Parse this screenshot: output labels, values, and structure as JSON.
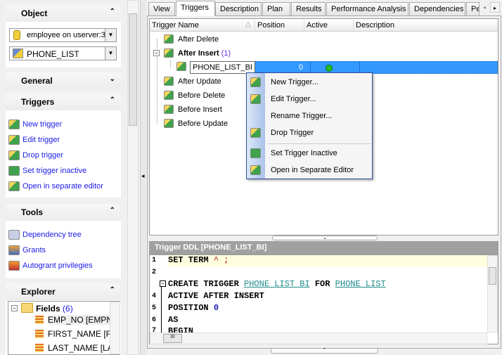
{
  "left": {
    "object": {
      "title": "Object",
      "database": "employee on userver:3",
      "table": "PHONE_LIST"
    },
    "general": {
      "title": "General"
    },
    "triggers": {
      "title": "Triggers",
      "items": [
        "New trigger",
        "Edit trigger",
        "Drop trigger",
        "Set trigger inactive",
        "Open in separate editor"
      ]
    },
    "tools": {
      "title": "Tools",
      "items": [
        "Dependency tree",
        "Grants",
        "Autogrant privilegies"
      ]
    },
    "explorer": {
      "title": "Explorer",
      "fields_label": "Fields",
      "fields_count": "(6)",
      "fields": [
        "EMP_NO [EMPN",
        "FIRST_NAME [FI",
        "LAST_NAME [LA"
      ]
    }
  },
  "tabs": [
    "View",
    "Triggers",
    "Description",
    "Plan",
    "Results",
    "Performance Analysis",
    "Dependencies",
    "Pe"
  ],
  "active_tab": "Triggers",
  "grid": {
    "columns": [
      "Trigger Name",
      "Position",
      "Active",
      "Description"
    ],
    "groups": [
      "After Delete",
      "After Insert",
      "After Update",
      "Before Delete",
      "Before Insert",
      "Before Update"
    ],
    "after_insert_count": "(1)",
    "selected": {
      "name": "PHONE_LIST_BI",
      "position": "0",
      "active": true
    }
  },
  "context_menu": [
    "New Trigger...",
    "Edit Trigger...",
    "Rename Trigger...",
    "Drop Trigger",
    "Set Trigger Inactive",
    "Open in Separate Editor"
  ],
  "ddl": {
    "title": "Trigger DDL [PHONE_LIST_BI]",
    "line_numbers": [
      "1",
      "2",
      "",
      "4",
      "5",
      "6",
      "7"
    ],
    "lines": {
      "l1a": "SET TERM ",
      "l1b": "^ ;",
      "l3a": "CREATE TRIGGER ",
      "l3b": "PHONE LIST BI",
      "l3c": " FOR ",
      "l3d": "PHONE LIST",
      "l4": "ACTIVE AFTER INSERT",
      "l5a": "POSITION ",
      "l5b": "0",
      "l6": "AS",
      "l7": "BEGIN"
    }
  },
  "colors": {
    "selection": "#3399ff",
    "link": "#1a1ae6",
    "active_dot": "#22bb22",
    "ddl_header": "#a0a0a0",
    "current_line": "#ffffe0"
  }
}
